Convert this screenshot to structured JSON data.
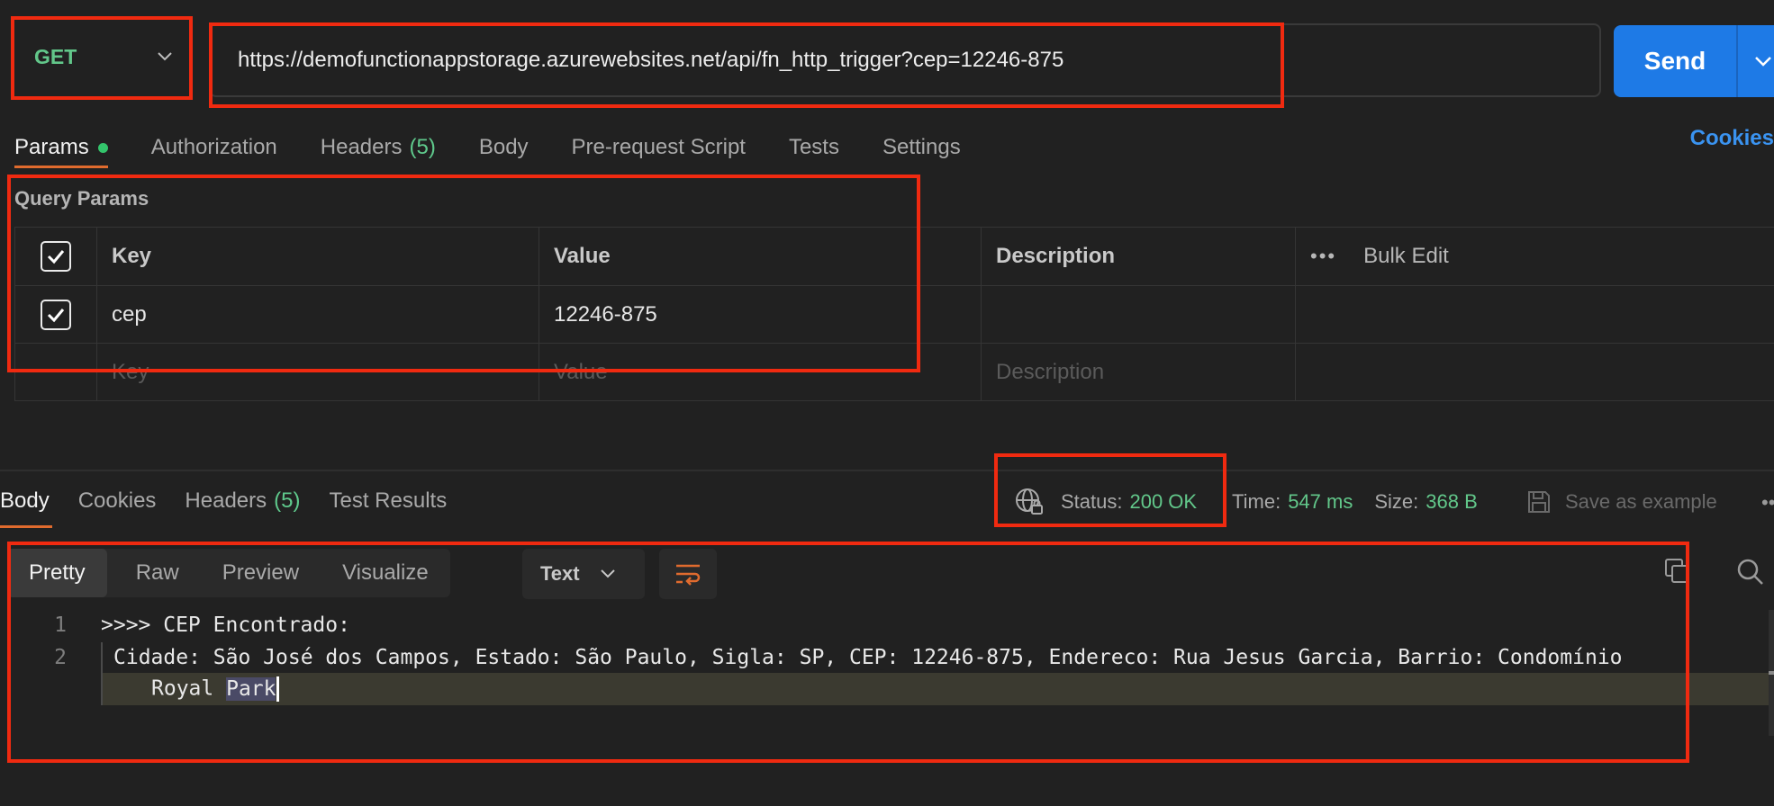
{
  "request": {
    "method": "GET",
    "url": "https://demofunctionappstorage.azurewebsites.net/api/fn_http_trigger?cep=12246-875",
    "send_label": "Send"
  },
  "request_tabs": {
    "params": "Params",
    "authorization": "Authorization",
    "headers": "Headers",
    "headers_count": "(5)",
    "body": "Body",
    "prerequest": "Pre-request Script",
    "tests": "Tests",
    "settings": "Settings",
    "cookies": "Cookies"
  },
  "query_params": {
    "title": "Query Params",
    "headers": {
      "key": "Key",
      "value": "Value",
      "description": "Description",
      "bulk_edit": "Bulk Edit"
    },
    "rows": [
      {
        "key": "cep",
        "value": "12246-875"
      }
    ],
    "placeholders": {
      "key": "Key",
      "value": "Value",
      "description": "Description"
    }
  },
  "response_tabs": {
    "body": "Body",
    "cookies": "Cookies",
    "headers": "Headers",
    "headers_count": "(5)",
    "test_results": "Test Results"
  },
  "response_meta": {
    "status_label": "Status:",
    "status_value": "200 OK",
    "time_label": "Time:",
    "time_value": "547 ms",
    "size_label": "Size:",
    "size_value": "368 B",
    "save_example": "Save as example"
  },
  "body_view": {
    "modes": [
      "Pretty",
      "Raw",
      "Preview",
      "Visualize"
    ],
    "format": "Text"
  },
  "response_body": {
    "line_numbers": [
      "1",
      "2"
    ],
    "line1": ">>>> CEP Encontrado:",
    "line2": "Cidade: São José dos Campos, Estado: São Paulo, Sigla: SP, CEP: 12246-875, Endereco: Rua Jesus Garcia, Barrio: Condomínio",
    "line2_wrap_prefix": "Royal ",
    "line2_wrap_selected": "Park"
  },
  "colors": {
    "accent_orange": "#e06b2e",
    "send_blue": "#1e7ae6",
    "success_green": "#62c78a",
    "highlight_red": "#f02a10"
  }
}
